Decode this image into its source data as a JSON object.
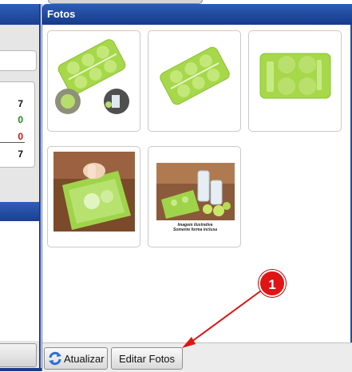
{
  "panel": {
    "title": "Fotos"
  },
  "left": {
    "stats": {
      "total": "7",
      "green": "0",
      "red": "0",
      "sum": "7"
    }
  },
  "photos": {
    "caption_line1": "Imagem ilustrativa",
    "caption_line2": "Somente forma inclusa"
  },
  "toolbar": {
    "refresh_label": "Atualizar",
    "edit_label": "Editar Fotos"
  },
  "annotation": {
    "marker": "1"
  },
  "colors": {
    "header": "#1a3f8f",
    "product_green": "#a6d84a",
    "marker_red": "#e01414",
    "stat_green": "#1a8a1a",
    "stat_red": "#d01010"
  }
}
